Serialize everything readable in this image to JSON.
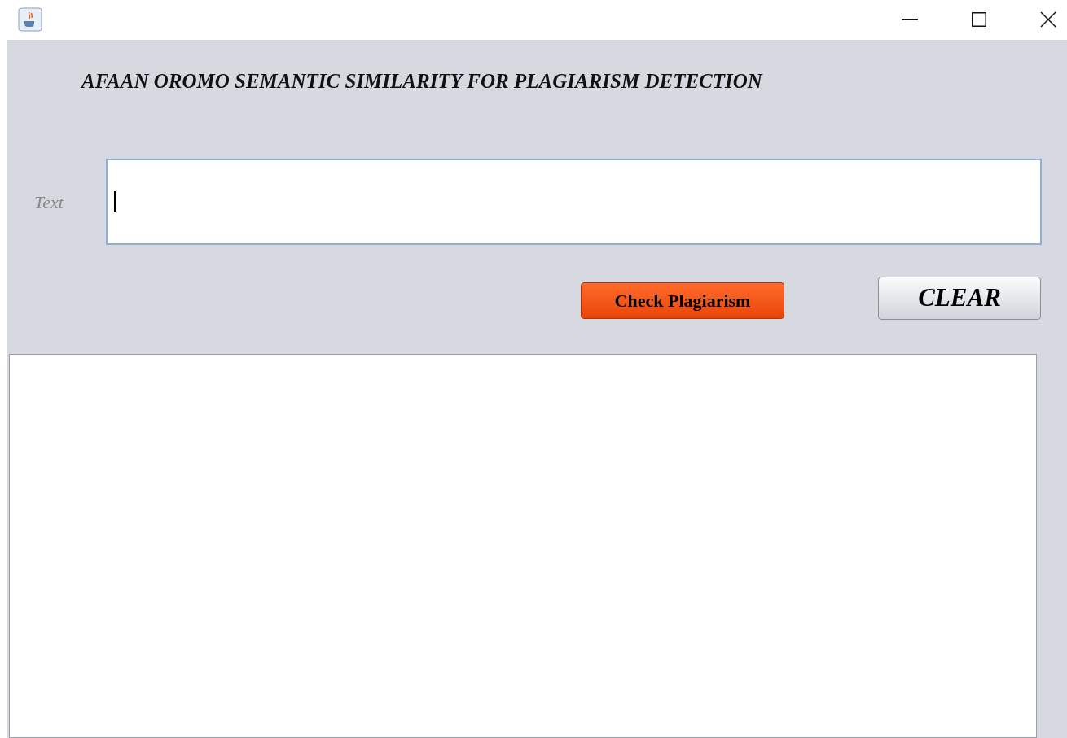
{
  "window": {
    "controls": [
      {
        "kind": "minimize"
      },
      {
        "kind": "maximize"
      },
      {
        "kind": "close"
      }
    ]
  },
  "heading": "AFAAN OROMO SEMANTIC SIMILARITY FOR PLAGIARISM DETECTION",
  "text_input": {
    "label": "Text",
    "focused": true
  },
  "buttons": [
    {
      "kind": "primary",
      "label": "Check Plagiarism"
    },
    {
      "kind": "secondary",
      "label": "CLEAR"
    }
  ]
}
